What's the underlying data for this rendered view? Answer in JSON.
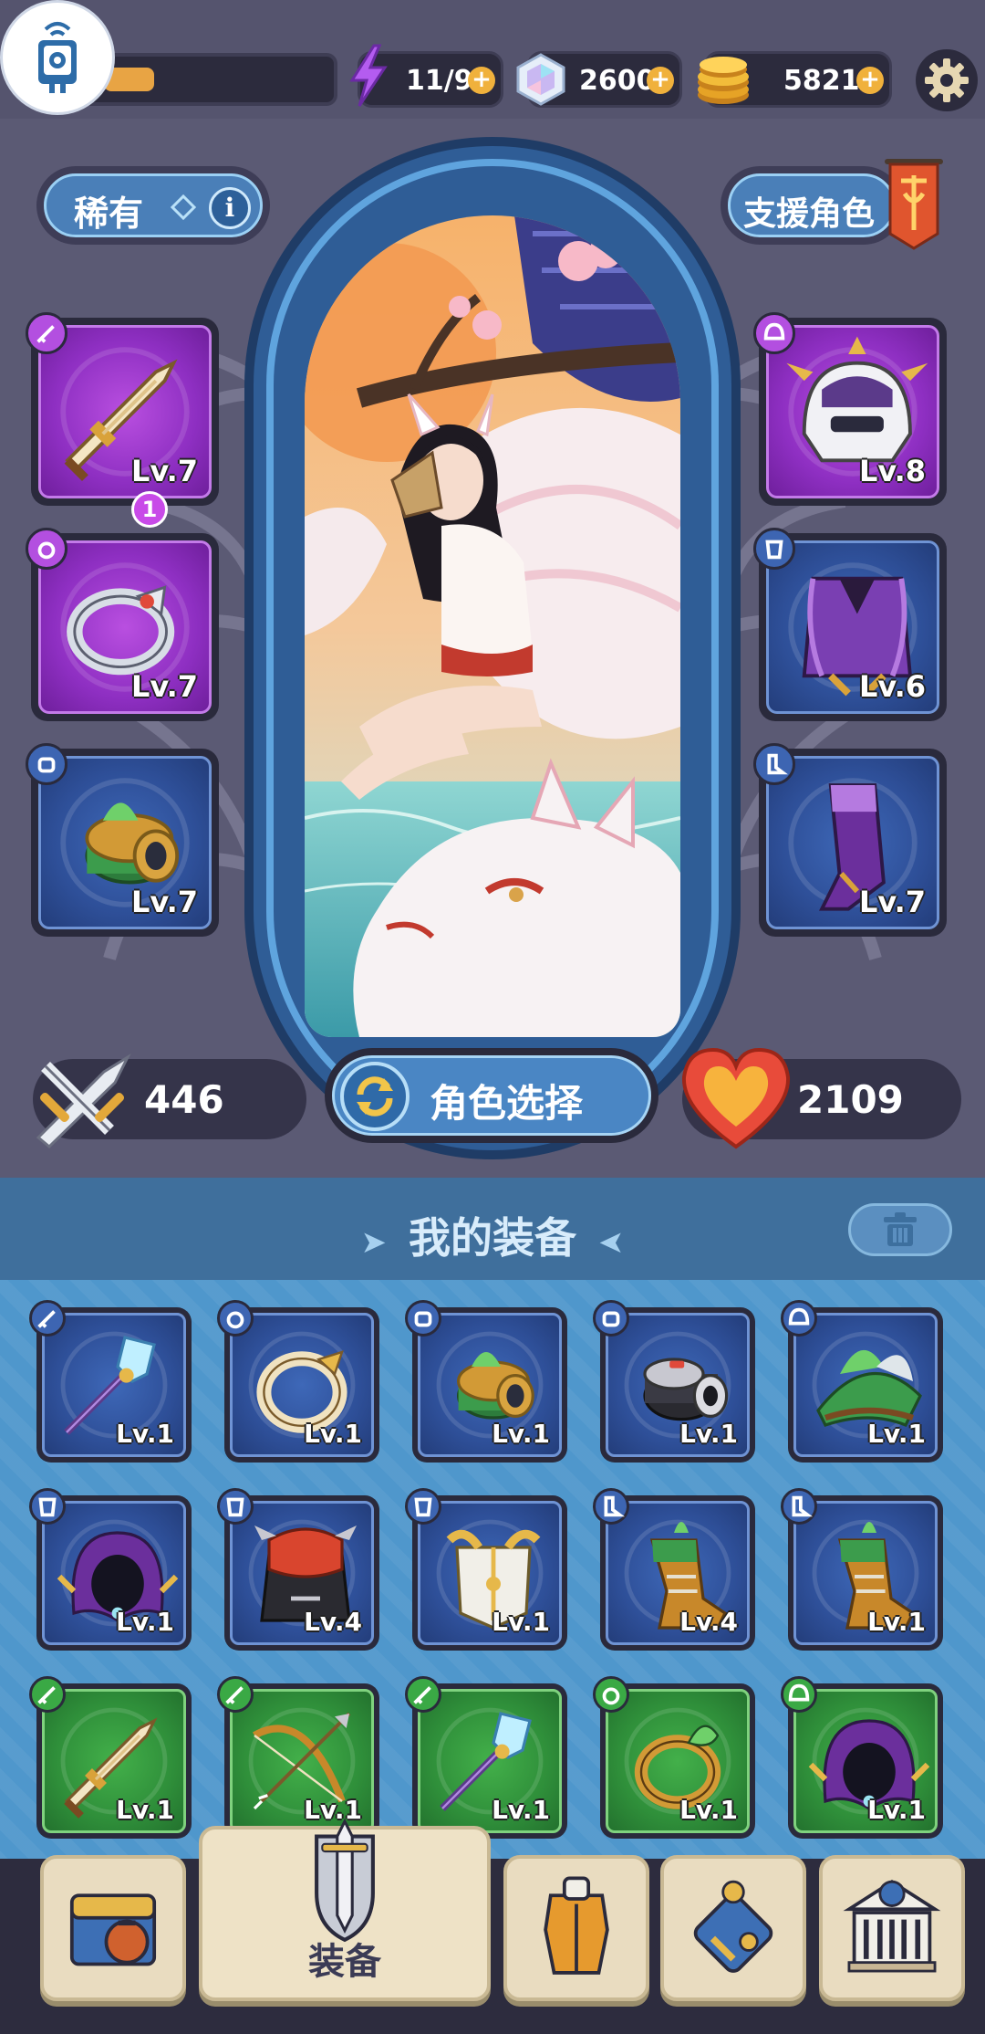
{
  "topbar": {
    "xp_fraction": 0.22,
    "energy": "11/90",
    "gems": "2600",
    "gold": "5821",
    "plus": "+"
  },
  "hero": {
    "rarity_label": "稀有",
    "info_glyph": "i",
    "support_label": "支援角色",
    "slots_left": [
      {
        "level": "Lv.7",
        "rarity": "purple",
        "item_icon": "golden-sword-icon",
        "category_icon": "sword-category-icon",
        "badge": "1"
      },
      {
        "level": "Lv.7",
        "rarity": "purple",
        "item_icon": "silver-ring-icon",
        "category_icon": "ring-category-icon"
      },
      {
        "level": "Lv.7",
        "rarity": "blue",
        "item_icon": "leaf-bracer-icon",
        "category_icon": "bracer-category-icon"
      }
    ],
    "slots_right": [
      {
        "level": "Lv.8",
        "rarity": "purple",
        "item_icon": "golden-helmet-icon",
        "category_icon": "helmet-category-icon"
      },
      {
        "level": "Lv.6",
        "rarity": "blue",
        "item_icon": "purple-armor-icon",
        "category_icon": "armor-category-icon"
      },
      {
        "level": "Lv.7",
        "rarity": "blue",
        "item_icon": "purple-boots-icon",
        "category_icon": "boots-category-icon"
      }
    ],
    "attack": "446",
    "health": "2109",
    "char_select_label": "角色选择"
  },
  "inventory": {
    "title": "我的装备",
    "items": [
      {
        "level": "Lv.1",
        "rarity": "blue",
        "item_icon": "crystal-staff-icon",
        "category_icon": "sword-category-icon"
      },
      {
        "level": "Lv.1",
        "rarity": "blue",
        "item_icon": "gold-ring-icon",
        "category_icon": "ring-category-icon"
      },
      {
        "level": "Lv.1",
        "rarity": "blue",
        "item_icon": "leaf-bracer-icon",
        "category_icon": "bracer-category-icon"
      },
      {
        "level": "Lv.1",
        "rarity": "blue",
        "item_icon": "black-bracer-icon",
        "category_icon": "bracer-category-icon"
      },
      {
        "level": "Lv.1",
        "rarity": "blue",
        "item_icon": "leaf-hat-icon",
        "category_icon": "helmet-category-icon"
      },
      {
        "level": "Lv.1",
        "rarity": "blue",
        "item_icon": "purple-hood-icon",
        "category_icon": "armor-category-icon"
      },
      {
        "level": "Lv.4",
        "rarity": "blue",
        "item_icon": "red-cape-armor-icon",
        "category_icon": "armor-category-icon"
      },
      {
        "level": "Lv.1",
        "rarity": "blue",
        "item_icon": "gold-armor-icon",
        "category_icon": "armor-category-icon"
      },
      {
        "level": "Lv.4",
        "rarity": "blue",
        "item_icon": "green-boots-icon",
        "category_icon": "boots-category-icon"
      },
      {
        "level": "Lv.1",
        "rarity": "blue",
        "item_icon": "green-boots-icon",
        "category_icon": "boots-category-icon"
      },
      {
        "level": "Lv.1",
        "rarity": "green",
        "item_icon": "golden-sword-icon",
        "category_icon": "sword-category-icon"
      },
      {
        "level": "Lv.1",
        "rarity": "green",
        "item_icon": "bow-icon",
        "category_icon": "sword-category-icon"
      },
      {
        "level": "Lv.1",
        "rarity": "green",
        "item_icon": "crystal-staff-icon",
        "category_icon": "sword-category-icon"
      },
      {
        "level": "Lv.1",
        "rarity": "green",
        "item_icon": "leaf-ring-icon",
        "category_icon": "ring-category-icon"
      },
      {
        "level": "Lv.1",
        "rarity": "green",
        "item_icon": "purple-hood-icon",
        "category_icon": "helmet-category-icon"
      }
    ]
  },
  "nav": {
    "items": [
      {
        "icon": "treasure-chest-icon"
      },
      {
        "icon": "sword-shield-icon",
        "label": "装备"
      },
      {
        "icon": "armor-stand-icon"
      },
      {
        "icon": "skill-tree-icon"
      },
      {
        "icon": "bank-building-icon"
      }
    ]
  },
  "colors": {
    "background": "#5b5a74",
    "purple_rarity": "#b94fe0",
    "blue_rarity": "#3e68b8",
    "green_rarity": "#43b04a",
    "accent_gold": "#f0b13c"
  }
}
